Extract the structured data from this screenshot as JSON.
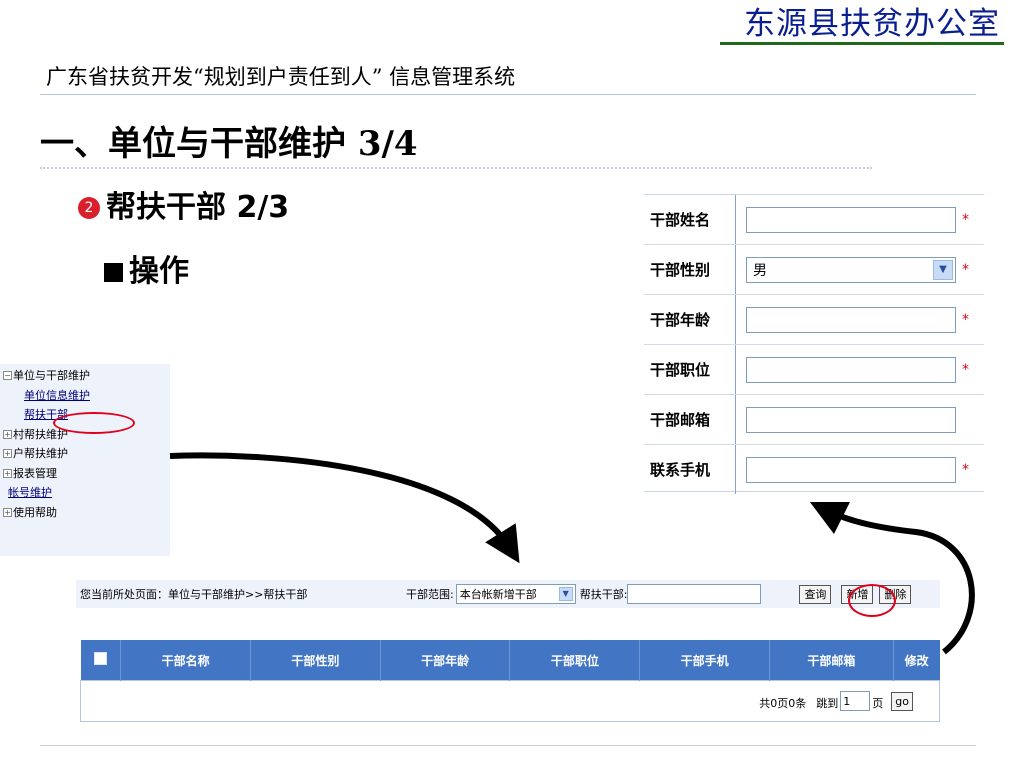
{
  "header": {
    "org_title": "东源县扶贫办公室",
    "system_title": "广东省扶贫开发“规划到户责任到人”  信息管理系统"
  },
  "slide": {
    "section_title": "一、单位与干部维护 3/4",
    "bullet_number": "2",
    "subsection_title": "帮扶干部 2/3",
    "operation_title": "操作"
  },
  "nav": {
    "toggle_expanded": "−",
    "toggle_collapsed": "+",
    "items": [
      {
        "label": "单位与干部维护"
      },
      {
        "label": "单位信息维护"
      },
      {
        "label": "帮扶干部"
      },
      {
        "label": "村帮扶维护"
      },
      {
        "label": "户帮扶维护"
      },
      {
        "label": "报表管理"
      },
      {
        "label": "帐号维护"
      },
      {
        "label": "使用帮助"
      }
    ]
  },
  "form": {
    "required_mark": "*",
    "select_arrow": "▼",
    "fields": [
      {
        "label": "干部姓名",
        "value": ""
      },
      {
        "label": "干部性别",
        "value": "男"
      },
      {
        "label": "干部年龄",
        "value": ""
      },
      {
        "label": "干部职位",
        "value": ""
      },
      {
        "label": "干部邮箱",
        "value": ""
      },
      {
        "label": "联系手机",
        "value": ""
      }
    ]
  },
  "toolbar": {
    "breadcrumb": "您当前所处页面：单位与干部维护>>帮扶干部",
    "scope_label": "干部范围:",
    "scope_value": "本台帐新增干部",
    "cadre_label": "帮扶干部:",
    "cadre_value": "",
    "query_button": "查询",
    "add_button": "新增",
    "delete_button": "删除"
  },
  "table": {
    "columns": [
      "干部名称",
      "干部性别",
      "干部年龄",
      "干部职位",
      "干部手机",
      "干部邮箱",
      "修改"
    ],
    "summary": "共0页0条",
    "jump_label": "跳到",
    "page_value": "1",
    "page_unit": "页",
    "go_button": "go"
  },
  "colors": {
    "org_title": "#0a1f8f",
    "table_header": "#4276c5",
    "highlight_circle": "#e0001c",
    "bullet": "#d8202c"
  }
}
